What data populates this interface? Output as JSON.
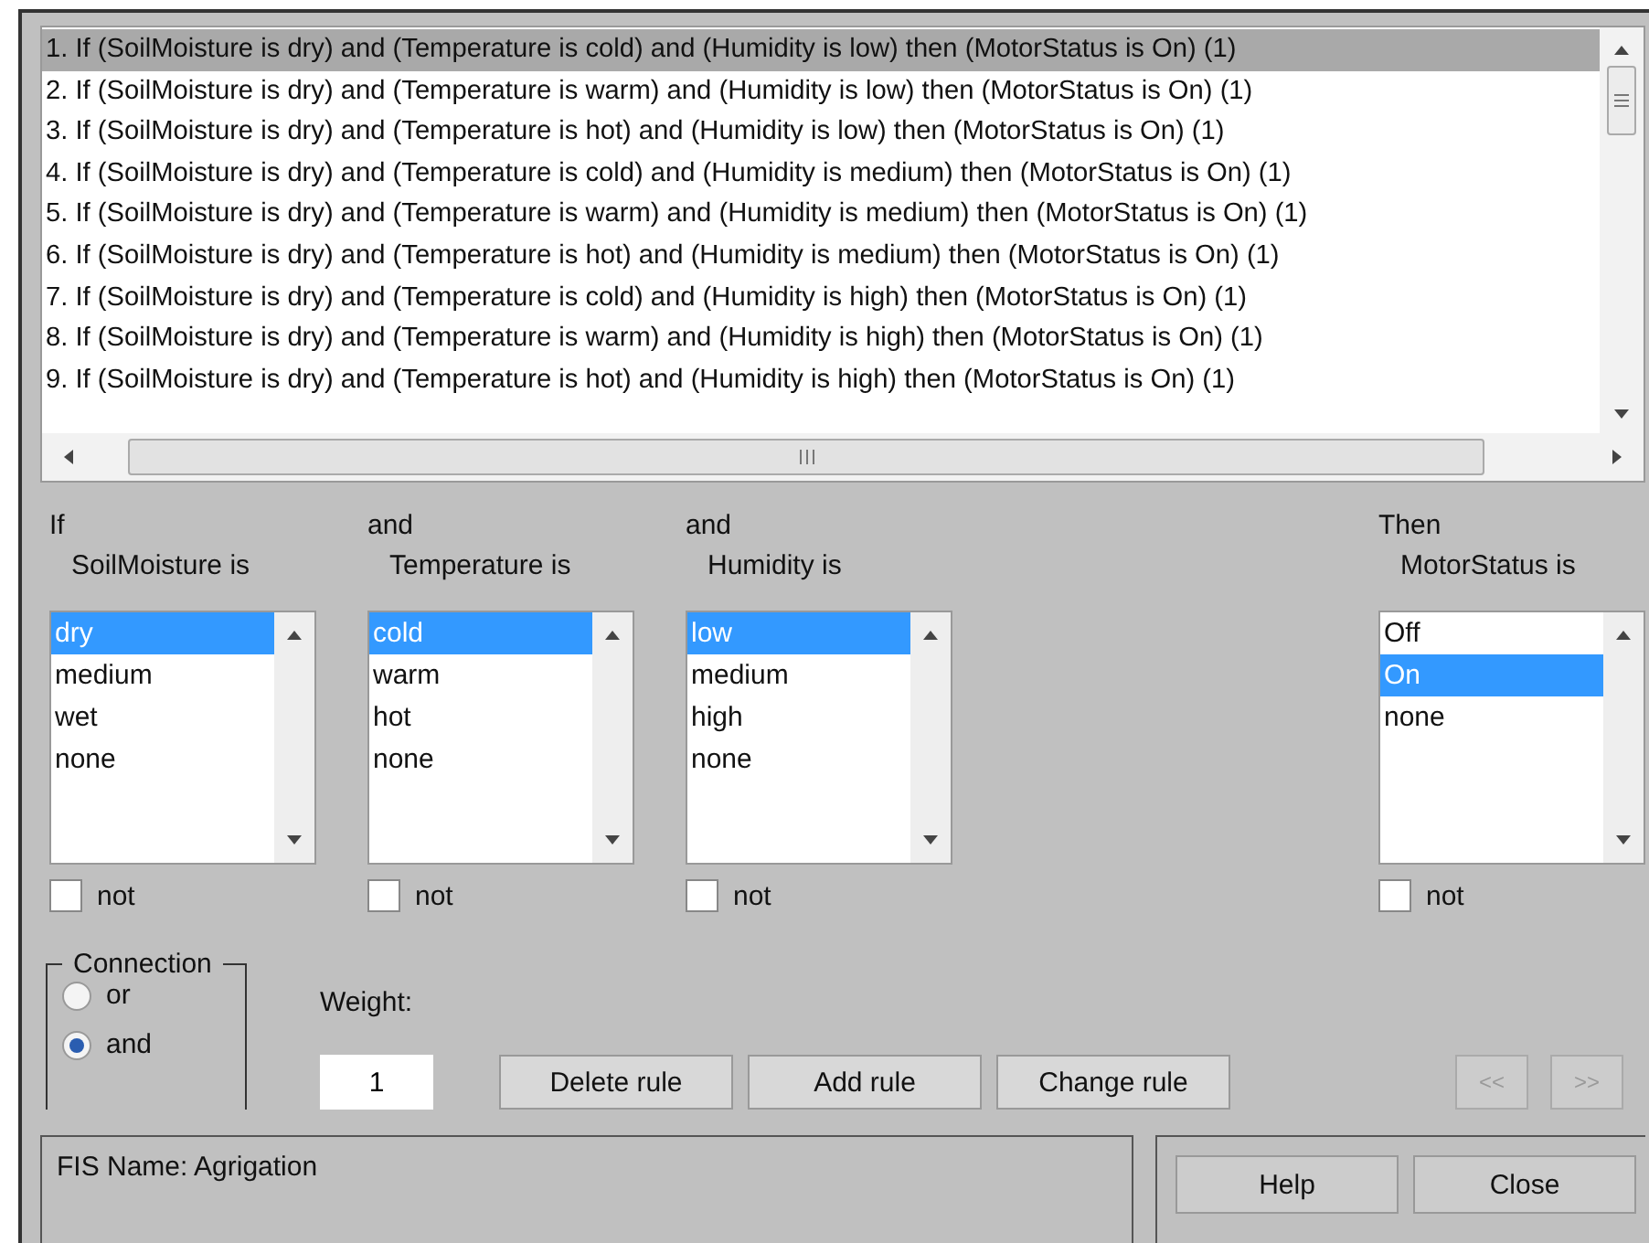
{
  "rules": [
    {
      "text": "1. If (SoilMoisture is dry) and (Temperature is cold) and (Humidity is low) then (MotorStatus is On) (1)",
      "selected": true
    },
    {
      "text": "2. If (SoilMoisture is dry) and (Temperature is warm) and (Humidity is low) then (MotorStatus is On) (1)",
      "selected": false
    },
    {
      "text": "3. If (SoilMoisture is dry) and (Temperature is hot) and (Humidity is low) then (MotorStatus is On) (1)",
      "selected": false
    },
    {
      "text": "4. If (SoilMoisture is dry) and (Temperature is cold) and (Humidity is medium) then (MotorStatus is On) (1)",
      "selected": false
    },
    {
      "text": "5. If (SoilMoisture is dry) and (Temperature is warm) and (Humidity is medium) then (MotorStatus is On) (1)",
      "selected": false
    },
    {
      "text": "6. If (SoilMoisture is dry) and (Temperature is hot) and (Humidity is medium) then (MotorStatus is On) (1)",
      "selected": false
    },
    {
      "text": "7. If (SoilMoisture is dry) and (Temperature is cold) and (Humidity is high) then (MotorStatus is On) (1)",
      "selected": false
    },
    {
      "text": "8. If (SoilMoisture is dry) and (Temperature is warm) and (Humidity is high) then (MotorStatus is On) (1)",
      "selected": false
    },
    {
      "text": "9. If (SoilMoisture is dry) and (Temperature is hot) and (Humidity is high) then (MotorStatus is On) (1)",
      "selected": false
    }
  ],
  "variables": [
    {
      "kind": "input",
      "connector": "If",
      "label": "SoilMoisture is",
      "options": [
        {
          "label": "dry",
          "selected": true
        },
        {
          "label": "medium",
          "selected": false
        },
        {
          "label": "wet",
          "selected": false
        },
        {
          "label": "none",
          "selected": false
        }
      ],
      "not_label": "not",
      "not_checked": false
    },
    {
      "kind": "input",
      "connector": "and",
      "label": "Temperature is",
      "options": [
        {
          "label": "cold",
          "selected": true
        },
        {
          "label": "warm",
          "selected": false
        },
        {
          "label": "hot",
          "selected": false
        },
        {
          "label": "none",
          "selected": false
        }
      ],
      "not_label": "not",
      "not_checked": false
    },
    {
      "kind": "input",
      "connector": "and",
      "label": "Humidity is",
      "options": [
        {
          "label": "low",
          "selected": true
        },
        {
          "label": "medium",
          "selected": false
        },
        {
          "label": "high",
          "selected": false
        },
        {
          "label": "none",
          "selected": false
        }
      ],
      "not_label": "not",
      "not_checked": false
    },
    {
      "kind": "output",
      "connector": "Then",
      "label": "MotorStatus is",
      "options": [
        {
          "label": "Off",
          "selected": false
        },
        {
          "label": "On",
          "selected": true
        },
        {
          "label": "none",
          "selected": false
        }
      ],
      "not_label": "not",
      "not_checked": false
    }
  ],
  "connection": {
    "title": "Connection",
    "options": [
      {
        "label": "or",
        "selected": false
      },
      {
        "label": "and",
        "selected": true
      }
    ]
  },
  "weight": {
    "label": "Weight:",
    "value": "1"
  },
  "buttons": [
    {
      "label": "Delete rule",
      "disabled": false
    },
    {
      "label": "Add rule",
      "disabled": false
    },
    {
      "label": "Change rule",
      "disabled": false
    }
  ],
  "nav_buttons": [
    {
      "label": "<<",
      "disabled": true
    },
    {
      "label": ">>",
      "disabled": true
    }
  ],
  "status": "FIS Name: Agrigation",
  "footer_buttons": [
    {
      "label": "Help"
    },
    {
      "label": "Close"
    }
  ]
}
